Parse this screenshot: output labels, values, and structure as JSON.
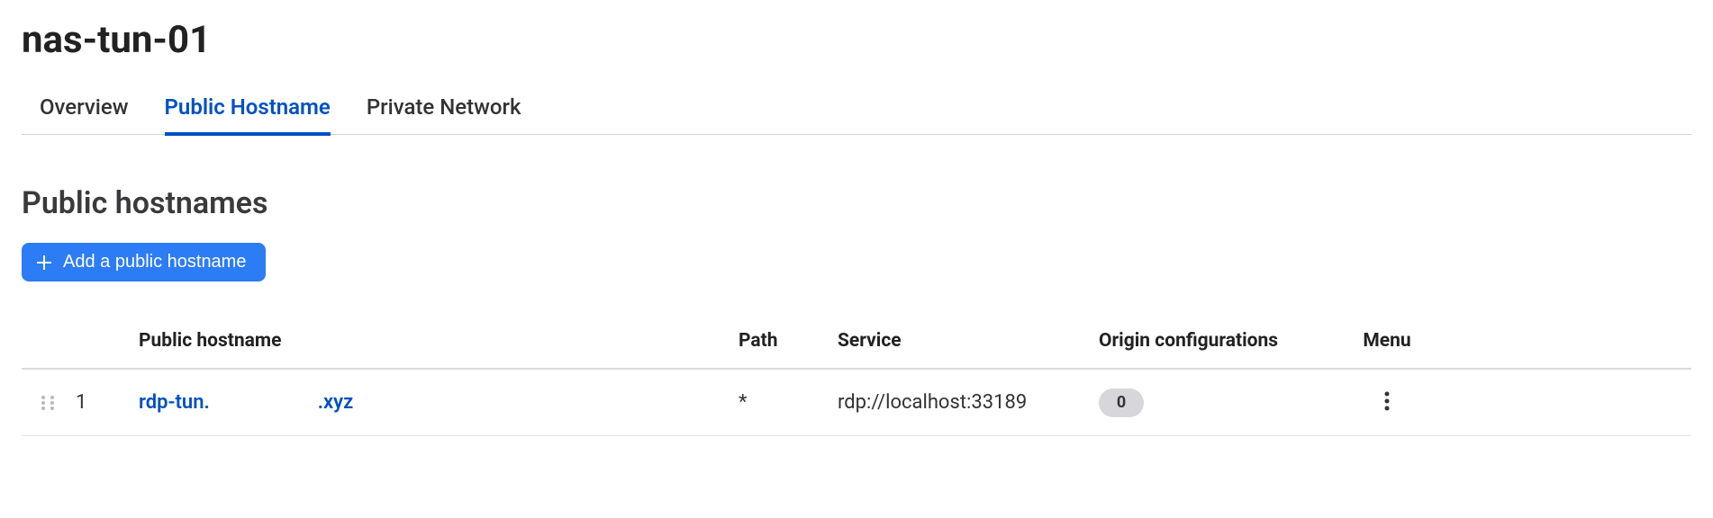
{
  "page_title": "nas-tun-01",
  "tabs": [
    {
      "label": "Overview",
      "active": false
    },
    {
      "label": "Public Hostname",
      "active": true
    },
    {
      "label": "Private Network",
      "active": false
    }
  ],
  "section_title": "Public hostnames",
  "add_button_label": "Add a public hostname",
  "table": {
    "columns": {
      "hostname": "Public hostname",
      "path": "Path",
      "service": "Service",
      "origin": "Origin configurations",
      "menu": "Menu"
    },
    "rows": [
      {
        "index": "1",
        "hostname_sub": "rdp-tun.",
        "hostname_domain": ".xyz",
        "path": "*",
        "service": "rdp://localhost:33189",
        "origin_count": "0"
      }
    ]
  }
}
